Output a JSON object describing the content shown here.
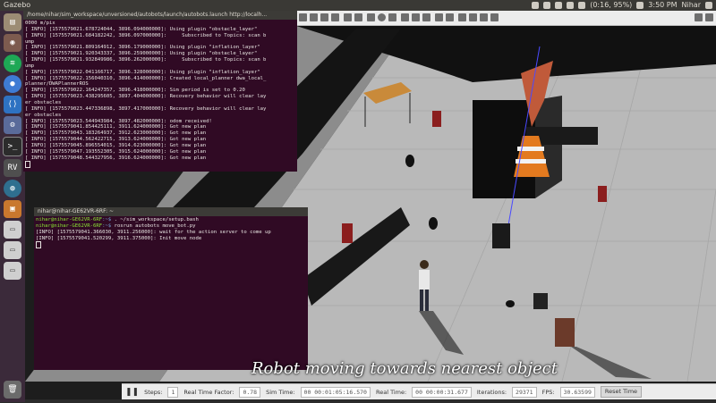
{
  "topbar": {
    "app_name": "Gazebo",
    "battery": "(0:16, 95%)",
    "time": "3:50 PM",
    "user": "Nihar"
  },
  "launcher": {
    "items": [
      "files",
      "firefox",
      "spotify",
      "chromium",
      "vscode",
      "settings",
      "terminal",
      "rviz",
      "world",
      "box",
      "drive1",
      "drive2",
      "drive3",
      "trash"
    ]
  },
  "term1": {
    "title": "/home/nihar/sim_workspace/unversioned/autobots/launch/autobots.launch http://localh...",
    "lines": [
      "0000 m/pix",
      "[ INFO] [1575579021.678724044, 3896.094000000]: Using plugin \"obstacle_layer\"",
      "[ INFO] [1575579021.684182242, 3896.097000000]:     Subscribed to Topics: scan b",
      "ump",
      "[ INFO] [1575579021.809164912, 3896.179000000]: Using plugin \"inflation_layer\"",
      "[ INFO] [1575579021.920343337, 3896.259000000]: Using plugin \"obstacle_layer\"",
      "[ INFO] [1575579021.932849986, 3896.262000000]:     Subscribed to Topics: scan b",
      "ump",
      "[ INFO] [1575579022.041166717, 3896.328000000]: Using plugin \"inflation_layer\"",
      "[ INFO] [1575579022.156040310, 3896.414000000]: Created local_planner dwa_local_",
      "planner/DWAPlannerROS",
      "[ INFO] [1575579022.164247357, 3896.418000000]: Sim period is set to 0.20",
      "[ INFO] [1575579023.438295605, 3897.404000000]: Recovery behavior will clear lay",
      "er obstacles",
      "[ INFO] [1575579023.447336898, 3897.417000000]: Recovery behavior will clear lay",
      "er obstacles",
      "[ INFO] [1575579023.544943984, 3897.482000000]: odom received!",
      "[ INFO] [1575579041.854425111, 3911.624000000]: Got new plan",
      "[ INFO] [1575579043.183264937, 3912.623000000]: Got new plan",
      "[ INFO] [1575579044.562422715, 3913.624000000]: Got new plan",
      "[ INFO] [1575579045.896554015, 3914.623000000]: Got new plan",
      "[ INFO] [1575579047.193552305, 3915.624000000]: Got new plan",
      "[ INFO] [1575579048.544327956, 3916.624000000]: Got new plan"
    ]
  },
  "term2": {
    "title": "nihar@nihar-GE62VR-6RF: ~",
    "prompt_user": "nihar@nihar-GE62VR-6RF",
    "prompt_path": ":~$",
    "cmd1": " . ~/sim_workspace/setup.bash",
    "cmd2": " rosrun autobots move_bot.py",
    "lines": [
      "[INFO] [1575579041.366030, 3911.256000]: wait for the action server to come up",
      "[INFO] [1575579041.520299, 3911.375000]: Init move node"
    ]
  },
  "gazebo": {
    "steps_label": "Steps:",
    "steps_value": "1",
    "rtf_label": "Real Time Factor:",
    "rtf_value": "0.78",
    "simtime_label": "Sim Time:",
    "simtime_value": "00 00:01:05:16.570",
    "realtime_label": "Real Time:",
    "realtime_value": "00 00:00:31.677",
    "iter_label": "Iterations:",
    "iter_value": "29371",
    "fps_label": "FPS:",
    "fps_value": "30.63599",
    "reset_label": "Reset Time"
  },
  "caption": "Robot moving towards nearest object"
}
